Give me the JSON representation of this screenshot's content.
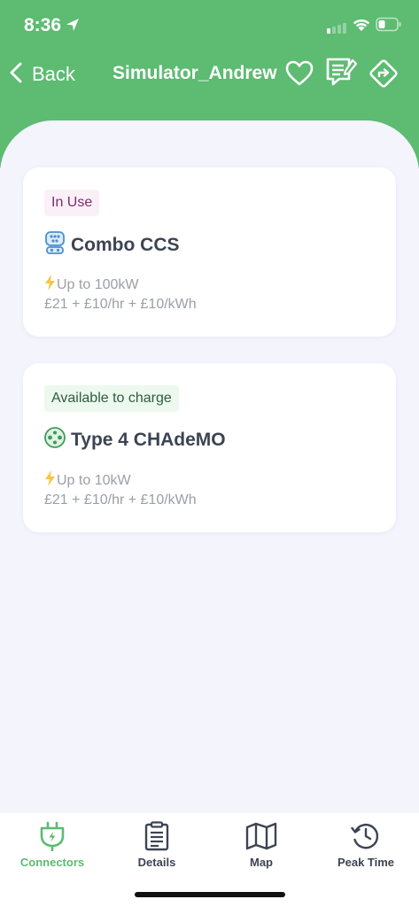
{
  "status_bar": {
    "time": "8:36"
  },
  "nav": {
    "back_label": "Back",
    "title": "Simulator_Andrew",
    "icons": [
      "heart-icon",
      "review-icon",
      "directions-icon"
    ]
  },
  "connectors": [
    {
      "status": "In Use",
      "name": "Combo CCS",
      "power": "Up to 100kW",
      "price": "£21 + £10/hr + £10/kWh"
    },
    {
      "status": "Available to charge",
      "name": "Type 4 CHAdeMO",
      "power": "Up to 10kW",
      "price": "£21 + £10/hr + £10/kWh"
    }
  ],
  "tabs": [
    {
      "label": "Connectors",
      "icon": "plug-icon",
      "active": true
    },
    {
      "label": "Details",
      "icon": "clipboard-icon",
      "active": false
    },
    {
      "label": "Map",
      "icon": "map-icon",
      "active": false
    },
    {
      "label": "Peak Time",
      "icon": "history-clock-icon",
      "active": false
    }
  ],
  "colors": {
    "brand_green": "#5dbb72",
    "in_use_badge_bg": "#faf0f8",
    "in_use_badge_text": "#7a2d6c",
    "available_badge_bg": "#edf8ef",
    "available_badge_text": "#2f5c3a",
    "lightning": "#f5c542"
  }
}
